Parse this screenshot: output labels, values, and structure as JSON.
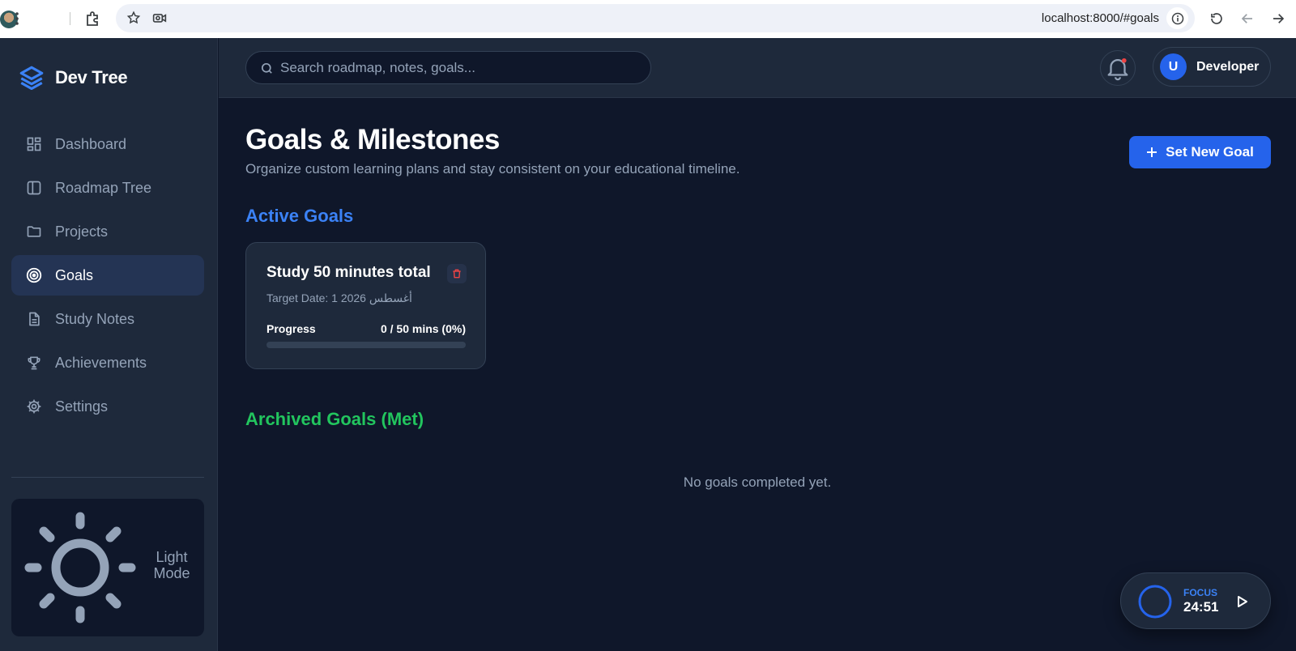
{
  "browser": {
    "url": "localhost:8000/#goals"
  },
  "sidebar": {
    "brand": "Dev Tree",
    "items": [
      {
        "label": "Dashboard",
        "icon": "dashboard-icon",
        "active": false
      },
      {
        "label": "Roadmap Tree",
        "icon": "columns-icon",
        "active": false
      },
      {
        "label": "Projects",
        "icon": "folder-icon",
        "active": false
      },
      {
        "label": "Goals",
        "icon": "target-icon",
        "active": true
      },
      {
        "label": "Study Notes",
        "icon": "document-icon",
        "active": false
      },
      {
        "label": "Achievements",
        "icon": "trophy-icon",
        "active": false
      },
      {
        "label": "Settings",
        "icon": "gear-icon",
        "active": false
      }
    ],
    "theme_toggle": {
      "label": "Light Mode",
      "icon": "sun-icon"
    }
  },
  "header": {
    "search_placeholder": "Search roadmap, notes, goals...",
    "user_initial": "U",
    "user_name": "Developer"
  },
  "main": {
    "title": "Goals & Milestones",
    "subtitle": "Organize custom learning plans and stay consistent on your educational timeline.",
    "new_goal_label": "Set New Goal",
    "active_heading": "Active Goals",
    "goals": [
      {
        "title": "Study 50 minutes total",
        "target_date": "Target Date: 1 أغسطس 2026",
        "progress_label": "Progress",
        "progress_value": "0 / 50 mins (0%)",
        "progress_fraction": 0
      }
    ],
    "archived_heading": "Archived Goals (Met)",
    "archived_empty": "No goals completed yet."
  },
  "focus": {
    "label": "FOCUS",
    "time": "24:51"
  },
  "colors": {
    "accent": "#2563eb",
    "active_heading": "#3b82f6",
    "archived_heading": "#22c55e",
    "danger": "#ef4444",
    "bg": "#0f172a",
    "panel": "#1e293b"
  }
}
